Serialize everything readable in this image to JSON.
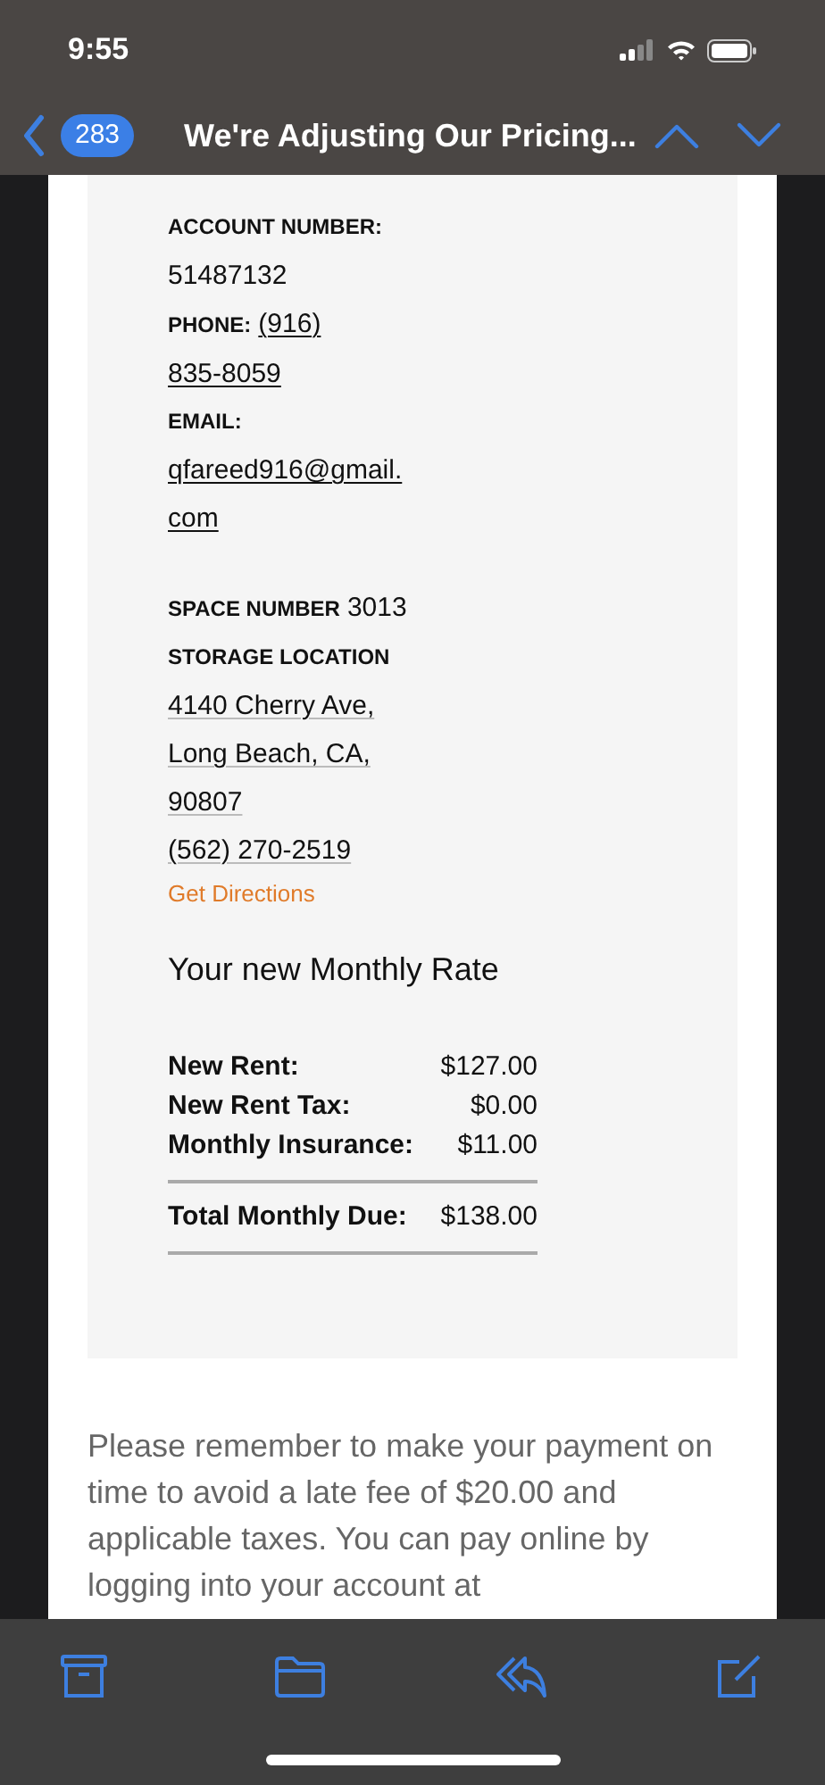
{
  "status_bar": {
    "time": "9:55"
  },
  "nav": {
    "badge": "283",
    "title": "We're Adjusting Our Pricing..."
  },
  "account": {
    "account_label": "ACCOUNT NUMBER:",
    "account_number": "51487132",
    "phone_label": "PHONE:",
    "phone_lines": [
      "(916)",
      "835-8059"
    ],
    "email_label": "EMAIL:",
    "email_lines": [
      "qfareed916@gmail.",
      "com"
    ],
    "space_label": "SPACE NUMBER",
    "space_number": "3013",
    "location_label": "STORAGE LOCATION",
    "address_lines": [
      "4140 Cherry Ave,",
      "Long Beach, CA,",
      "90807"
    ],
    "location_phone": "(562) 270-2519",
    "directions_link": "Get Directions"
  },
  "rate": {
    "heading": "Your new Monthly Rate",
    "rows": [
      {
        "label": "New Rent:",
        "amount": "$127.00"
      },
      {
        "label": "New Rent Tax:",
        "amount": "$0.00"
      },
      {
        "label": "Monthly Insurance:",
        "amount": "$11.00"
      }
    ],
    "total": {
      "label": "Total Monthly Due:",
      "amount": "$138.00"
    }
  },
  "message": "Please remember to make your payment on time to avoid a late fee of $20.00 and applicable taxes. You can pay online by logging into your account at"
}
